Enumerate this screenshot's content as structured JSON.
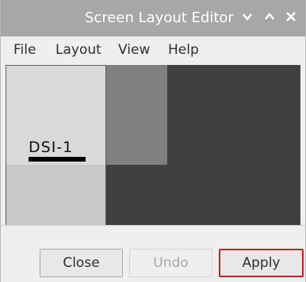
{
  "window": {
    "title": "Screen Layout Editor",
    "controls": {
      "minimize_icon": "chevron-down",
      "maximize_icon": "chevron-up",
      "close_icon": "close-x"
    }
  },
  "menu": {
    "items": [
      {
        "label": "File"
      },
      {
        "label": "Layout"
      },
      {
        "label": "View"
      },
      {
        "label": "Help"
      }
    ]
  },
  "layout": {
    "monitors": [
      {
        "label": "DSI-1"
      }
    ]
  },
  "buttons": {
    "close_label": "Close",
    "undo_label": "Undo",
    "apply_label": "Apply"
  },
  "colors": {
    "titlebar": "#a7a7a7",
    "canvas": "#404040",
    "highlight": "#c41e25"
  }
}
